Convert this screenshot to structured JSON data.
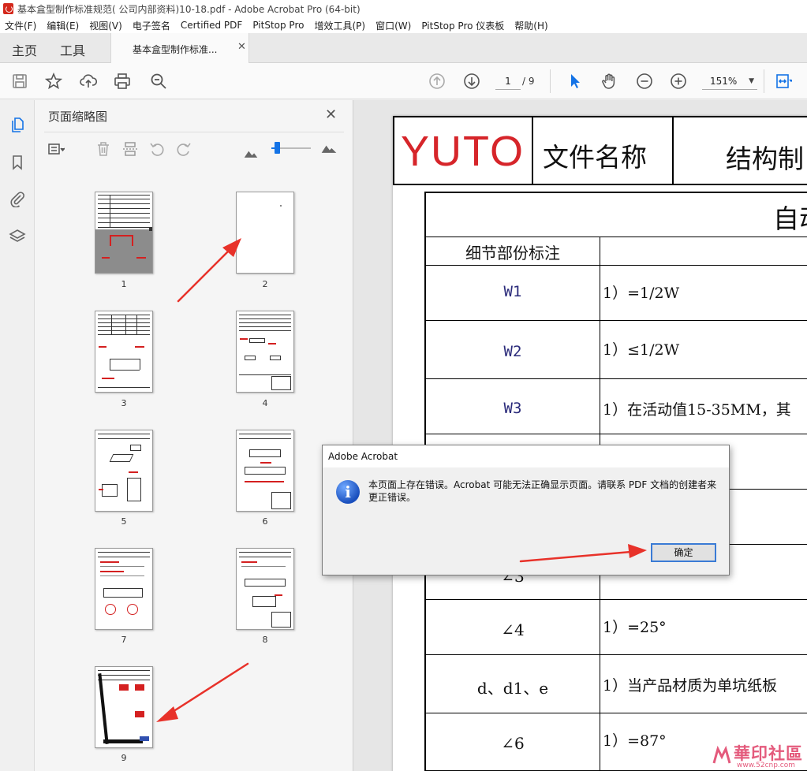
{
  "window": {
    "title": "基本盒型制作标准规范( 公司内部资料)10-18.pdf - Adobe Acrobat Pro (64-bit)"
  },
  "menubar": {
    "items": [
      "文件(F)",
      "编辑(E)",
      "视图(V)",
      "电子签名",
      "Certified PDF",
      "PitStop Pro",
      "增效工具(P)",
      "窗口(W)",
      "PitStop Pro 仪表板",
      "帮助(H)"
    ]
  },
  "tabs": {
    "home": "主页",
    "tools": "工具",
    "document": "基本盒型制作标准...",
    "close_glyph": "✕"
  },
  "toolbar": {
    "page_current": "1",
    "page_total": "/ 9",
    "zoom": "151%",
    "icons": [
      "save-icon",
      "star-icon",
      "cloud-upload-icon",
      "print-icon",
      "search-zoom-icon",
      "page-up-icon",
      "page-down-icon",
      "select-pointer-icon",
      "hand-icon",
      "zoom-out-icon",
      "zoom-in-icon",
      "fit-page-icon"
    ],
    "accent": "#1473e6"
  },
  "sidebar": {
    "panel_title": "页面缩略图",
    "close_glyph": "✕",
    "rail_icons": [
      "pages-icon",
      "bookmark-icon",
      "attachment-icon",
      "layers-icon"
    ],
    "thumbnails": [
      {
        "label": "1"
      },
      {
        "label": "2"
      },
      {
        "label": "3"
      },
      {
        "label": "4"
      },
      {
        "label": "5"
      },
      {
        "label": "6"
      },
      {
        "label": "7"
      },
      {
        "label": "8"
      },
      {
        "label": "9"
      }
    ],
    "thumbnail_size_level": 0.1
  },
  "document": {
    "logo": "YUTO",
    "header_name": "文件名称",
    "header_struct": "结构制",
    "table_title": "自动",
    "column_header": "细节部份标注",
    "rows": [
      {
        "left": "W1",
        "right": "1）=1/2W"
      },
      {
        "left": "W2",
        "right": "1）≤1/2W"
      },
      {
        "left": "W3",
        "right": "1）在活动值15-35MM，其"
      },
      {
        "left": "",
        "right": ""
      },
      {
        "left": "",
        "right": ""
      },
      {
        "left": "∠3",
        "right": ""
      },
      {
        "left": "∠4",
        "right": "1）=25°"
      },
      {
        "left": "d、d1、e",
        "right": "1）当产品材质为单坑纸板"
      },
      {
        "left": "∠6",
        "right": "1）=87°"
      }
    ]
  },
  "dialog": {
    "title": "Adobe Acrobat",
    "icon": "info-icon",
    "message": "本页面上存在错误。Acrobat 可能无法正确显示页面。请联系 PDF 文档的创建者来更正错误。",
    "ok_label": "确定"
  },
  "watermark": {
    "name": "華印社區",
    "url": "www.52cnp.com"
  },
  "colors": {
    "logo_red": "#d6252a",
    "annotation_red": "#e8322a",
    "watermark_pink": "#e45a7c"
  }
}
